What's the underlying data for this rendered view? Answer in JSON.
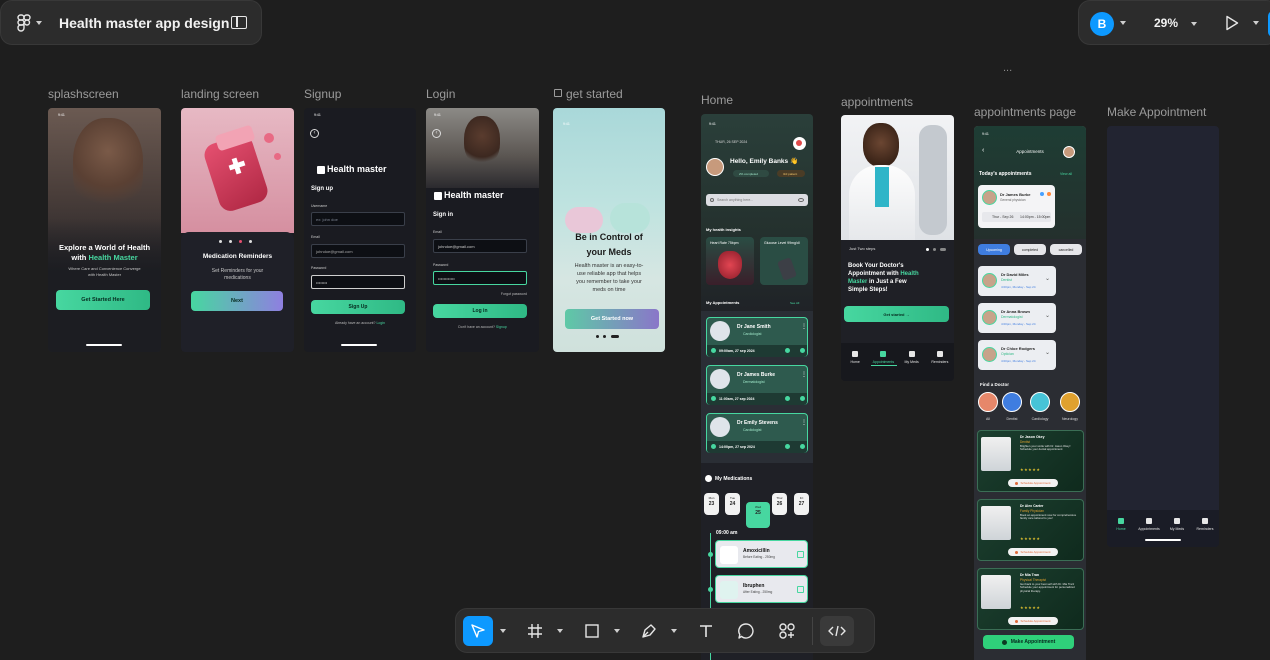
{
  "header": {
    "file_title": "Health master app design",
    "avatar_initial": "B",
    "zoom": "29%",
    "overflow_dots": "..."
  },
  "frames": {
    "splash": {
      "label": "splashscreen",
      "time": "9:41",
      "title_line1": "Explore a World of Health",
      "title_line2_prefix": "with ",
      "title_line2_brand": "Health Master",
      "sub_line1": "Where Care and Convenience Converge",
      "sub_line2": "with Health Master",
      "button": "Get Started Here"
    },
    "landing": {
      "label": "landing screen",
      "title": "Medication Reminders",
      "sub_line1": "Set Reminders for your",
      "sub_line2": "medications",
      "button": "Next"
    },
    "signup": {
      "label": "Signup",
      "time": "9:41",
      "brand": "Health master",
      "heading": "Sign up",
      "username_label": "Username",
      "username_placeholder": "ex: john doe",
      "email_label": "Email",
      "email_value": "johndoe@gmail.com",
      "password_label": "Password",
      "password_value": "••••••••",
      "button": "Sign Up",
      "footer": "Already have an account?",
      "footer_link": "Login"
    },
    "login": {
      "label": "Login",
      "time": "9:41",
      "brand": "Health master",
      "heading": "Sign in",
      "email_label": "Email",
      "email_value": "johndoe@gmail.com",
      "password_label": "Password",
      "password_value": "••••••••••••",
      "forgot": "Forgot password",
      "button": "Log in",
      "footer": "Don't have an account?",
      "footer_link": "Signup"
    },
    "get_started": {
      "label": "get started",
      "time": "9:41",
      "title_line1": "Be in Control of",
      "title_line2": "your Meds",
      "sub_line1": "Health master is an easy-to-",
      "sub_line2": "use reliable app that helps",
      "sub_line3": "you remember to take your",
      "sub_line4": "meds on time",
      "button": "Get Started now"
    },
    "home": {
      "label": "Home",
      "time": "9:41",
      "date": "THUR, 26 SEP 2024",
      "greeting": "Hello, Emily Banks 👋",
      "chip1": "2% completed",
      "chip2": "3rd patient",
      "search": "Search anything here...",
      "insights": "My health insights",
      "heart_rate": "Heart Rate  75bpm",
      "glucose": "Glucose Level 99mg/dl",
      "appointments": "My Appointments",
      "see_all": "See All",
      "appts": [
        {
          "name": "Dr Jane Smith",
          "spec": "Cardiologist",
          "time": "09:00am, 27 sep 2024"
        },
        {
          "name": "Dr James Burke",
          "spec": "Dermatologist",
          "time": "11:00am, 27 sep 2024"
        },
        {
          "name": "Dr Emily Stevens",
          "spec": "Cardiologist",
          "time": "14:00pm, 27 sep 2024"
        }
      ],
      "medications": "My Medications",
      "days": [
        {
          "d": "Mon",
          "n": "23"
        },
        {
          "d": "Tue",
          "n": "24"
        },
        {
          "d": "Wed",
          "n": "25"
        },
        {
          "d": "Thur",
          "n": "26"
        },
        {
          "d": "Fri",
          "n": "27"
        }
      ],
      "med_time": "09:00 am",
      "meds": [
        {
          "name": "Amoxicillin",
          "note": "Before Eating - 250mg"
        },
        {
          "name": "Ibruphen",
          "note": "After Eating - 250mg"
        }
      ]
    },
    "appointments": {
      "label": "appointments",
      "steps": "Just Two steps",
      "title_line1": "Book Your Doctor's",
      "title_line2_prefix": "Appointment with ",
      "title_line2_brand": "Health",
      "title_line3_brand": "Master",
      "title_line3_rest": " in Just a Few",
      "title_line4": "Simple Steps!",
      "button": "Get started",
      "nav": [
        "Home",
        "Appointments",
        "My Meds",
        "Reminders"
      ]
    },
    "appointments_page": {
      "label": "appointments page",
      "time": "9:41",
      "title": "Appointments",
      "today": "Today's appointments",
      "view_all": "View all",
      "featured_name": "Dr James Burke",
      "featured_spec": "General physician",
      "featured_date": "Thur - Sep 26",
      "featured_time": "14:00pm - 15:00pm",
      "tabs": [
        "Upcoming",
        "completed",
        "cancelled"
      ],
      "list": [
        {
          "name": "Dr David Miles",
          "spec": "Dentist",
          "time": "4:00pm, Monday - Sep 24"
        },
        {
          "name": "Dr Anna Brown",
          "spec": "Dermatologist",
          "time": "4:00pm, Monday - Sep 24"
        },
        {
          "name": "Dr Chloe Rodgers",
          "spec": "Optician",
          "time": "4:00pm, Monday - Sep 24"
        }
      ],
      "find": "Find a Doctor",
      "categories": [
        "All",
        "Dentist",
        "Cardiology",
        "Neurology"
      ],
      "doctors": [
        {
          "name": "Dr Jason Okey",
          "spec": "Dentist",
          "desc": "Brighten your smile with Dr. Jason Okey! Schedule your dental appointment"
        },
        {
          "name": "Dr Alex Carter",
          "spec": "Family Physician",
          "desc": "Book an appointment now for comprehensive family care tailored to you!"
        },
        {
          "name": "Dr Mia Tran",
          "spec": "Physical Therapist",
          "desc": "Get back to your best self with Dr. Mia Tran! Schedule your appointment for personalized physical therapy."
        }
      ],
      "doctor_button": "Schedule Appointment",
      "stars": "★★★★★",
      "make_button": "Make Appointment"
    },
    "make_appointment": {
      "label": "Make Appointment",
      "nav": [
        "Home",
        "Appointments",
        "My Meds",
        "Reminders"
      ]
    }
  },
  "colors": {
    "canvas": "#1e1e1e",
    "panel": "#2c2c2c",
    "accent_blue": "#0d99ff",
    "brand_green": "#47d7a0"
  },
  "toolbar": {
    "icons": [
      "move-tool-icon",
      "frame-tool-icon",
      "shape-tool-icon",
      "pen-tool-icon",
      "text-tool-icon",
      "comment-tool-icon",
      "actions-icon",
      "dev-mode-icon"
    ]
  }
}
